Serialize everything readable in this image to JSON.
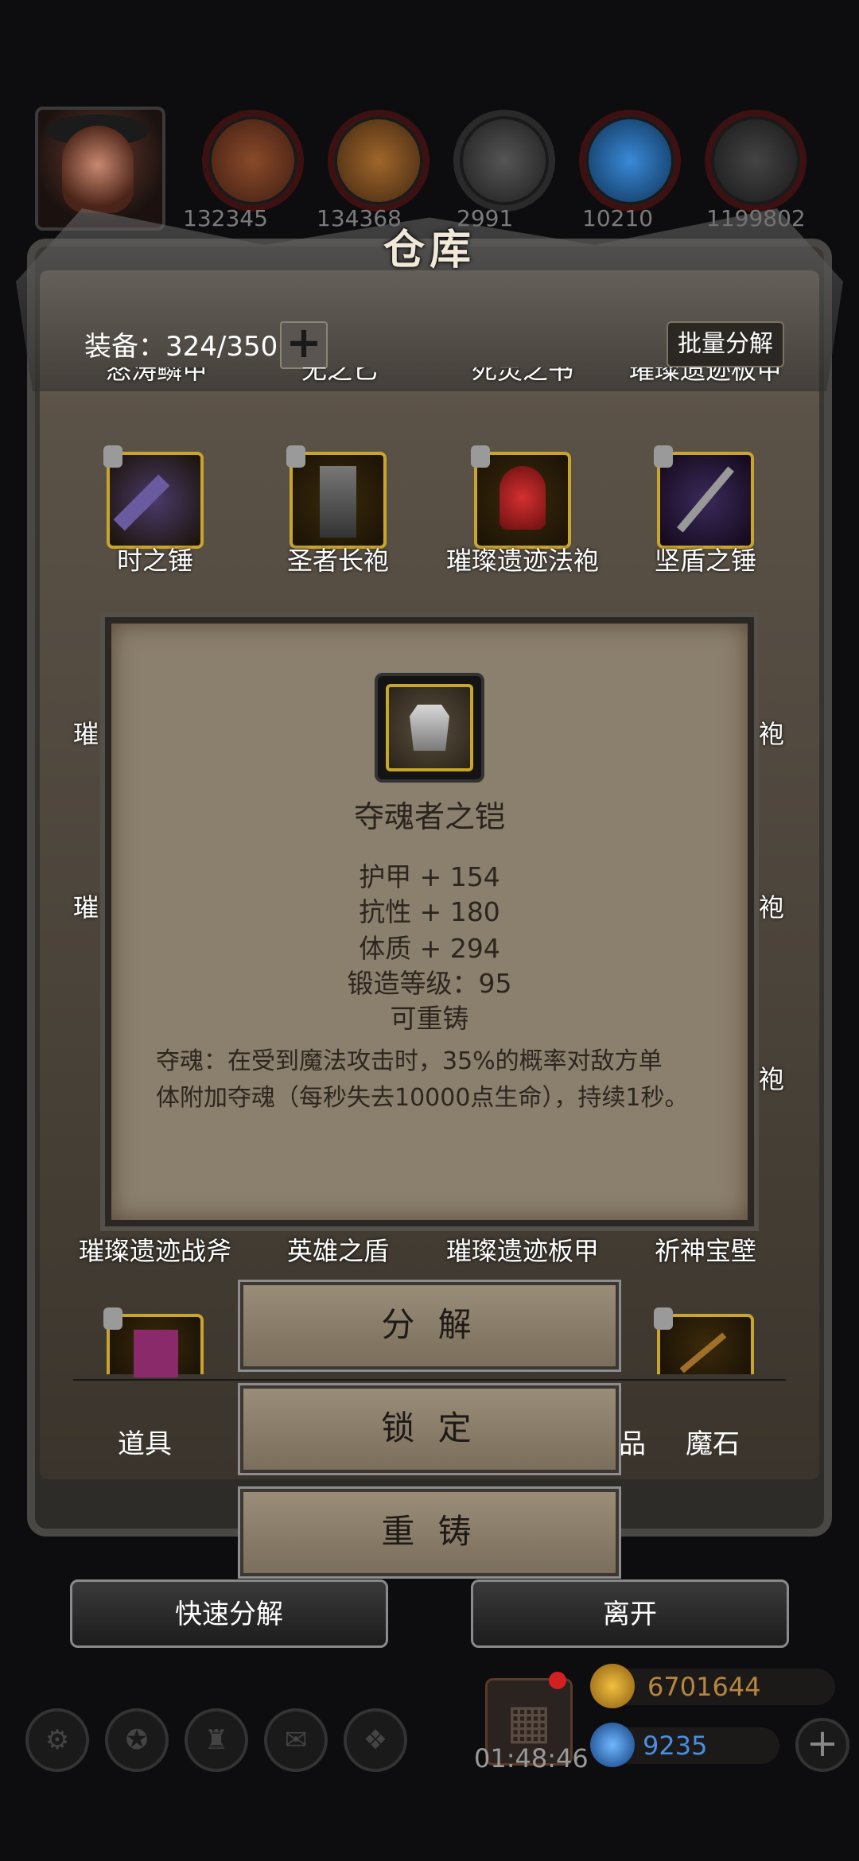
{
  "top_bar": {
    "resource_values": [
      "132345",
      "134368",
      "2991",
      "10210",
      "1199802"
    ]
  },
  "panel": {
    "title": "仓库",
    "equip_count": "装备：324/350",
    "plus_symbol": "+",
    "batch_button": "批量分解",
    "cut_row_labels": [
      "怒涛鳞甲",
      "无之匕",
      "死灵之书",
      "璀璨遗迹板甲"
    ],
    "row1": [
      "时之锤",
      "圣者长袍",
      "璀璨遗迹法袍",
      "坚盾之锤"
    ],
    "side_left": [
      "璀",
      "璀",
      "",
      ""
    ],
    "side_right": [
      "袍",
      "袍",
      "袍"
    ],
    "row_bottom_labels": [
      "璀璨遗迹战斧",
      "英雄之盾",
      "璀璨遗迹板甲",
      "祈神宝壁"
    ]
  },
  "tooltip": {
    "name": "夺魂者之铠",
    "stats": [
      "护甲 + 154",
      "抗性 + 180",
      "体质 + 294",
      "锻造等级：95",
      "可重铸"
    ],
    "desc_line1": "夺魂：在受到魔法攻击时，35%的概率对敌方单",
    "desc_line2": "体附加夺魂（每秒失去10000点生命），持续1秒。"
  },
  "actions": {
    "decompose": "分 解",
    "lock": "锁 定",
    "reforge": "重 铸"
  },
  "tabs": {
    "left": "道具",
    "partial": "品",
    "right": "魔石"
  },
  "bottom_buttons": {
    "quick_decompose": "快速分解",
    "leave": "离开"
  },
  "footer": {
    "timer": "01:48:46",
    "gold": "6701644",
    "gems": "9235",
    "add_symbol": "+"
  },
  "colors": {
    "rare_border": "#c9a52a",
    "tooltip_bg": "#8b7f6e",
    "gold_text": "#b8863c",
    "gem_text": "#4a8ee0"
  }
}
